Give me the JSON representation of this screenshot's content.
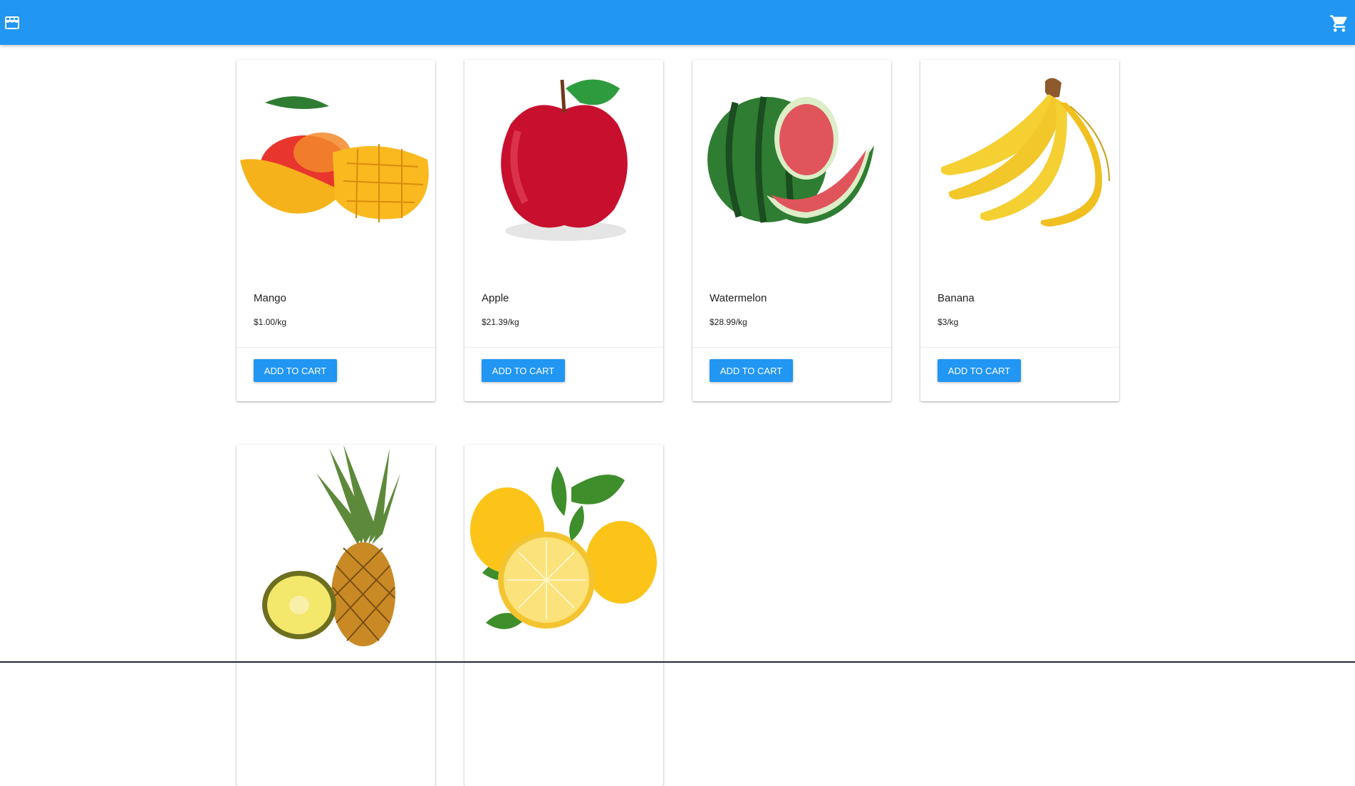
{
  "header": {
    "home_icon": "store-icon",
    "cart_icon": "shopping-cart-icon",
    "background_color": "#2196f3"
  },
  "products": [
    {
      "name": "Mango",
      "price": "$1.00/kg",
      "button_label": "ADD TO CART",
      "image": "mango-image"
    },
    {
      "name": "Apple",
      "price": "$21.39/kg",
      "button_label": "ADD TO CART",
      "image": "apple-image"
    },
    {
      "name": "Watermelon",
      "price": "$28.99/kg",
      "button_label": "ADD TO CART",
      "image": "watermelon-image"
    },
    {
      "name": "Banana",
      "price": "$3/kg",
      "button_label": "ADD TO CART",
      "image": "banana-image"
    },
    {
      "name": "",
      "price": "",
      "button_label": "",
      "image": "pineapple-image"
    },
    {
      "name": "",
      "price": "",
      "button_label": "",
      "image": "lemon-image"
    }
  ]
}
